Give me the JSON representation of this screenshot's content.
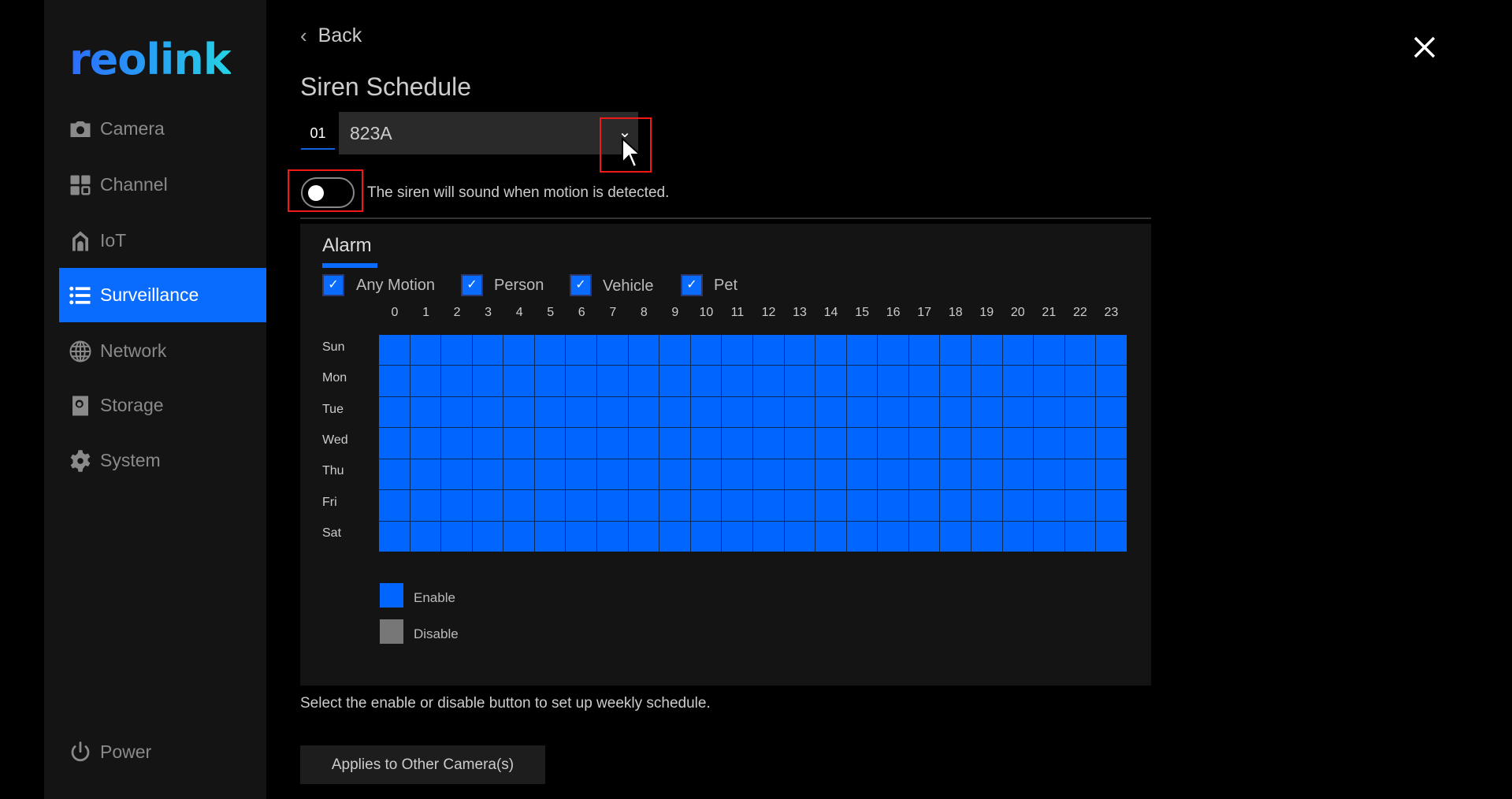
{
  "sidebar": {
    "logo": "reolink",
    "items": [
      {
        "label": "Camera",
        "icon": "camera-icon"
      },
      {
        "label": "Channel",
        "icon": "channel-icon"
      },
      {
        "label": "IoT",
        "icon": "iot-icon"
      },
      {
        "label": "Surveillance",
        "icon": "list-icon",
        "active": true
      },
      {
        "label": "Network",
        "icon": "globe-icon"
      },
      {
        "label": "Storage",
        "icon": "storage-icon"
      },
      {
        "label": "System",
        "icon": "gear-icon"
      }
    ],
    "power": "Power"
  },
  "header": {
    "back": "Back",
    "title": "Siren Schedule",
    "close_icon": "close-icon"
  },
  "camera": {
    "number": "01",
    "name": "823A"
  },
  "siren": {
    "enabled": false,
    "text": "The siren will sound when motion is detected."
  },
  "panel": {
    "tab": "Alarm",
    "filters": [
      {
        "label": "Any Motion",
        "checked": true
      },
      {
        "label": "Person",
        "checked": true
      },
      {
        "label": "Vehicle",
        "checked": true
      },
      {
        "label": "Pet",
        "checked": true
      }
    ],
    "hours": [
      "0",
      "1",
      "2",
      "3",
      "4",
      "5",
      "6",
      "7",
      "8",
      "9",
      "10",
      "11",
      "12",
      "13",
      "14",
      "15",
      "16",
      "17",
      "18",
      "19",
      "20",
      "21",
      "22",
      "23"
    ],
    "days": [
      "Sun",
      "Mon",
      "Tue",
      "Wed",
      "Thu",
      "Fri",
      "Sat"
    ],
    "schedule": [
      "111111111111111111111111",
      "111111111111111111111111",
      "111111111111111111111111",
      "111111111111111111111111",
      "111111111111111111111111",
      "111111111111111111111111",
      "111111111111111111111111"
    ],
    "legend": {
      "enable": "Enable",
      "disable": "Disable"
    },
    "colors": {
      "enable": "#0066ff",
      "disable": "#777777",
      "accent": "#0a6cff"
    }
  },
  "hint": "Select the enable or disable button to set up weekly schedule.",
  "apply_button": "Applies to Other Camera(s)"
}
